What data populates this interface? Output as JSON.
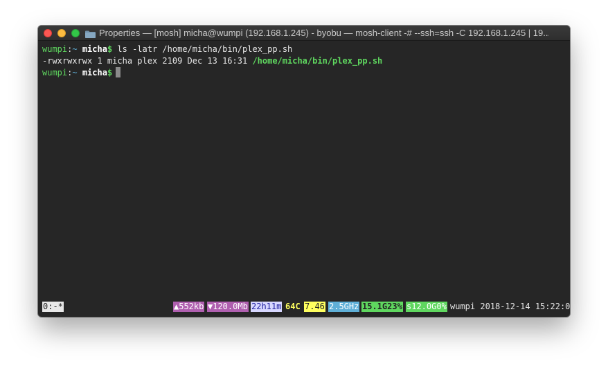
{
  "window": {
    "title": "Properties — [mosh] micha@wumpi (192.168.1.245) - byobu — mosh-client -# --ssh=ssh -C 192.168.1.245 | 19..."
  },
  "terminal": {
    "lines": [
      {
        "host": "wumpi",
        "sep": ":",
        "tilde": "~",
        "user": " micha",
        "dollar": "$",
        "cmd": " ls -latr /home/micha/bin/plex_pp.sh"
      },
      {
        "output": "-rwxrwxrwx 1 micha plex 2109 Dec 13 16:31 ",
        "path": "/home/micha/bin/plex_pp.sh"
      },
      {
        "host": "wumpi",
        "sep": ":",
        "tilde": "~",
        "user": " micha",
        "dollar": "$",
        "cmd": " "
      }
    ]
  },
  "statusbar": {
    "window": "0:-*",
    "net_up": "▲552kb",
    "net_down": "▼120.0Mb",
    "uptime": "22h11m",
    "temp": "64C",
    "load": "7.46",
    "cpu_freq": "2.5GHz",
    "memory": "15.1G23%",
    "disk": "s12.0G0%",
    "host_datetime": "wumpi 2018-12-14 15:22:0"
  },
  "colors": {
    "terminal_bg": "#262626",
    "prompt_host": "#5fd75f",
    "up_down_bg": "#af5faf",
    "load_bg": "#ffff5f",
    "cpu_bg": "#5fafd7",
    "mem_bg": "#5fd75f"
  }
}
